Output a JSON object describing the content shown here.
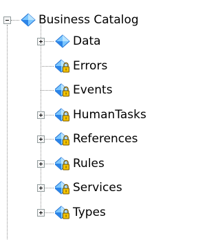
{
  "tree": {
    "root": {
      "label": "Business Catalog",
      "expanded": true,
      "icon": "business-catalog-icon"
    },
    "children": [
      {
        "label": "Data",
        "has_children": true,
        "locked": false
      },
      {
        "label": "Errors",
        "has_children": false,
        "locked": true
      },
      {
        "label": "Events",
        "has_children": false,
        "locked": true
      },
      {
        "label": "HumanTasks",
        "has_children": true,
        "locked": true
      },
      {
        "label": "References",
        "has_children": true,
        "locked": true
      },
      {
        "label": "Rules",
        "has_children": true,
        "locked": true
      },
      {
        "label": "Services",
        "has_children": true,
        "locked": true
      },
      {
        "label": "Types",
        "has_children": true,
        "locked": true
      }
    ]
  },
  "colors": {
    "diamond_light": "#7cc7ff",
    "diamond_dark": "#1f6fd1",
    "lock_body": "#f2c200",
    "lock_outline": "#7a5a00",
    "connector": "#8c8c8c"
  }
}
